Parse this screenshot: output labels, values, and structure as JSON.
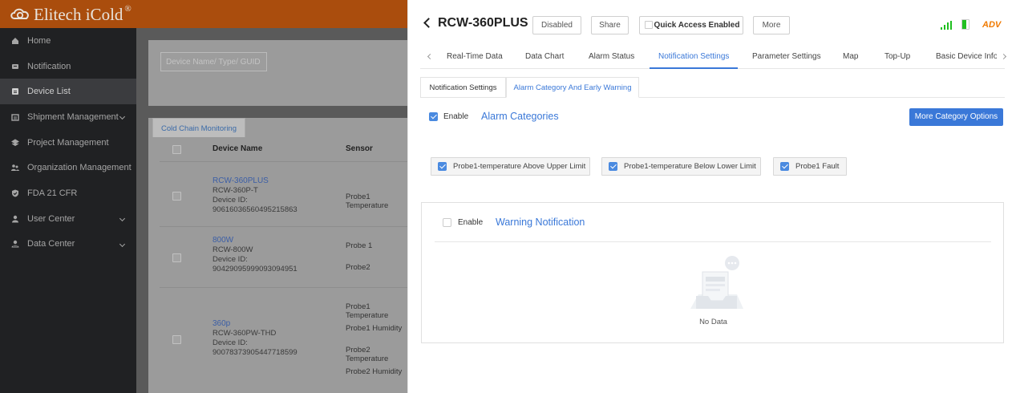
{
  "app": {
    "brand": "Elitech iCold",
    "brand_mark": "®"
  },
  "sidebar": {
    "items": [
      {
        "label": "Home",
        "icon": "home-icon"
      },
      {
        "label": "Notification",
        "icon": "notification-icon"
      },
      {
        "label": "Device List",
        "icon": "device-list-icon"
      },
      {
        "label": "Shipment Management",
        "icon": "shipment-icon"
      },
      {
        "label": "Project Management",
        "icon": "project-icon"
      },
      {
        "label": "Organization Management",
        "icon": "organization-icon"
      },
      {
        "label": "FDA 21 CFR",
        "icon": "shield-check-icon"
      },
      {
        "label": "User Center",
        "icon": "user-icon"
      },
      {
        "label": "Data Center",
        "icon": "data-center-icon"
      }
    ]
  },
  "device_list": {
    "search_placeholder": "Device Name/ Type/ GUID",
    "tab": "Cold Chain Monitoring",
    "columns": {
      "name": "Device Name",
      "sensor": "Sensor"
    },
    "device_id_label": "Device ID:",
    "rows": [
      {
        "name": "RCW-360PLUS",
        "model": "RCW-360P-T",
        "id": "90616036560495215863",
        "sensors": [
          "Probe1 Temperature"
        ]
      },
      {
        "name": "800W",
        "model": "RCW-800W",
        "id": "90429095999093094951",
        "sensors": [
          "Probe 1",
          "Probe2"
        ]
      },
      {
        "name": "360p",
        "model": "RCW-360PW-THD",
        "id": "90078373905447718599",
        "sensors": [
          "Probe1 Temperature",
          "Probe1 Humidity",
          "Probe2 Temperature",
          "Probe2 Humidity"
        ]
      }
    ]
  },
  "panel": {
    "title": "RCW-360PLUS",
    "buttons": {
      "disabled": "Disabled",
      "share": "Share",
      "quick_access": "Quick Access Enabled",
      "more": "More"
    },
    "adv": "ADV",
    "colors": {
      "accent": "#3a78d8",
      "adv": "#f07a00",
      "battery": "#1fbf1f"
    },
    "tabs": [
      "Real-Time Data",
      "Data Chart",
      "Alarm Status",
      "Notification Settings",
      "Parameter Settings",
      "Map",
      "Top-Up",
      "Basic Device Inform"
    ],
    "active_tab": "Notification Settings",
    "subtabs": [
      "Notification Settings",
      "Alarm Category And Early Warning"
    ],
    "alarm": {
      "enable_label": "Enable",
      "title": "Alarm Categories",
      "more_button": "More Category Options",
      "categories": [
        "Probe1-temperature Above Upper Limit",
        "Probe1-temperature Below Lower Limit",
        "Probe1 Fault"
      ]
    },
    "warning": {
      "enable_label": "Enable",
      "title": "Warning Notification",
      "empty": "No Data"
    }
  }
}
